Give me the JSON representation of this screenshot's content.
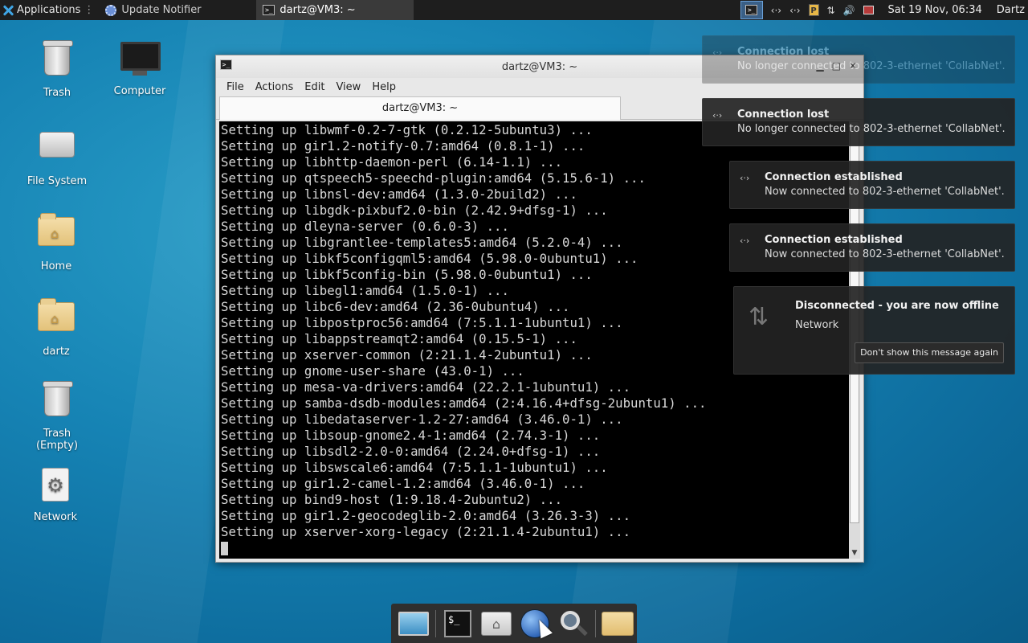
{
  "top_panel": {
    "applications_label": "Applications",
    "tasks": [
      {
        "label": "Update Notifier"
      },
      {
        "label": "dartz@VM3: ~"
      }
    ],
    "clock": "Sat 19 Nov, 06:34",
    "user": "Dartz",
    "tray_p_label": "P"
  },
  "desktop": {
    "icons": [
      {
        "label": "Trash"
      },
      {
        "label": "Computer"
      },
      {
        "label": "File System"
      },
      {
        "label": "Home"
      },
      {
        "label": "dartz"
      },
      {
        "label": "Trash (Empty)"
      },
      {
        "label": "Network"
      }
    ]
  },
  "terminal": {
    "window_title": "dartz@VM3: ~",
    "menu": [
      "File",
      "Actions",
      "Edit",
      "View",
      "Help"
    ],
    "tab_title": "dartz@VM3: ~",
    "lines": [
      "Setting up libwmf-0.2-7-gtk (0.2.12-5ubuntu3) ...",
      "Setting up gir1.2-notify-0.7:amd64 (0.8.1-1) ...",
      "Setting up libhttp-daemon-perl (6.14-1.1) ...",
      "Setting up qtspeech5-speechd-plugin:amd64 (5.15.6-1) ...",
      "Setting up libnsl-dev:amd64 (1.3.0-2build2) ...",
      "Setting up libgdk-pixbuf2.0-bin (2.42.9+dfsg-1) ...",
      "Setting up dleyna-server (0.6.0-3) ...",
      "Setting up libgrantlee-templates5:amd64 (5.2.0-4) ...",
      "Setting up libkf5configqml5:amd64 (5.98.0-0ubuntu1) ...",
      "Setting up libkf5config-bin (5.98.0-0ubuntu1) ...",
      "Setting up libegl1:amd64 (1.5.0-1) ...",
      "Setting up libc6-dev:amd64 (2.36-0ubuntu4) ...",
      "Setting up libpostproc56:amd64 (7:5.1.1-1ubuntu1) ...",
      "Setting up libappstreamqt2:amd64 (0.15.5-1) ...",
      "Setting up xserver-common (2:21.1.4-2ubuntu1) ...",
      "Setting up gnome-user-share (43.0-1) ...",
      "Setting up mesa-va-drivers:amd64 (22.2.1-1ubuntu1) ...",
      "Setting up samba-dsdb-modules:amd64 (2:4.16.4+dfsg-2ubuntu1) ...",
      "Setting up libedataserver-1.2-27:amd64 (3.46.0-1) ...",
      "Setting up libsoup-gnome2.4-1:amd64 (2.74.3-1) ...",
      "Setting up libsdl2-2.0-0:amd64 (2.24.0+dfsg-1) ...",
      "Setting up libswscale6:amd64 (7:5.1.1-1ubuntu1) ...",
      "Setting up gir1.2-camel-1.2:amd64 (3.46.0-1) ...",
      "Setting up bind9-host (1:9.18.4-2ubuntu2) ...",
      "Setting up gir1.2-geocodeglib-2.0:amd64 (3.26.3-3) ...",
      "Setting up xserver-xorg-legacy (2:21.1.4-2ubuntu1) ..."
    ]
  },
  "notifications": [
    {
      "title": "Connection lost",
      "body": "No longer connected to 802-3-ethernet 'CollabNet'."
    },
    {
      "title": "Connection lost",
      "body": "No longer connected to 802-3-ethernet 'CollabNet'."
    },
    {
      "title": "Connection established",
      "body": "Now connected to 802-3-ethernet 'CollabNet'."
    },
    {
      "title": "Connection established",
      "body": "Now connected to 802-3-ethernet 'CollabNet'."
    },
    {
      "title": "Disconnected - you are now offline",
      "body": "Network",
      "button": "Don't show this message again"
    }
  ],
  "colors": {
    "panel_bg": "#1e1e1e",
    "terminal_bg": "#000000",
    "terminal_fg": "#d8d8d8",
    "notification_bg": "#232323",
    "accent": "#3fa6e6"
  }
}
